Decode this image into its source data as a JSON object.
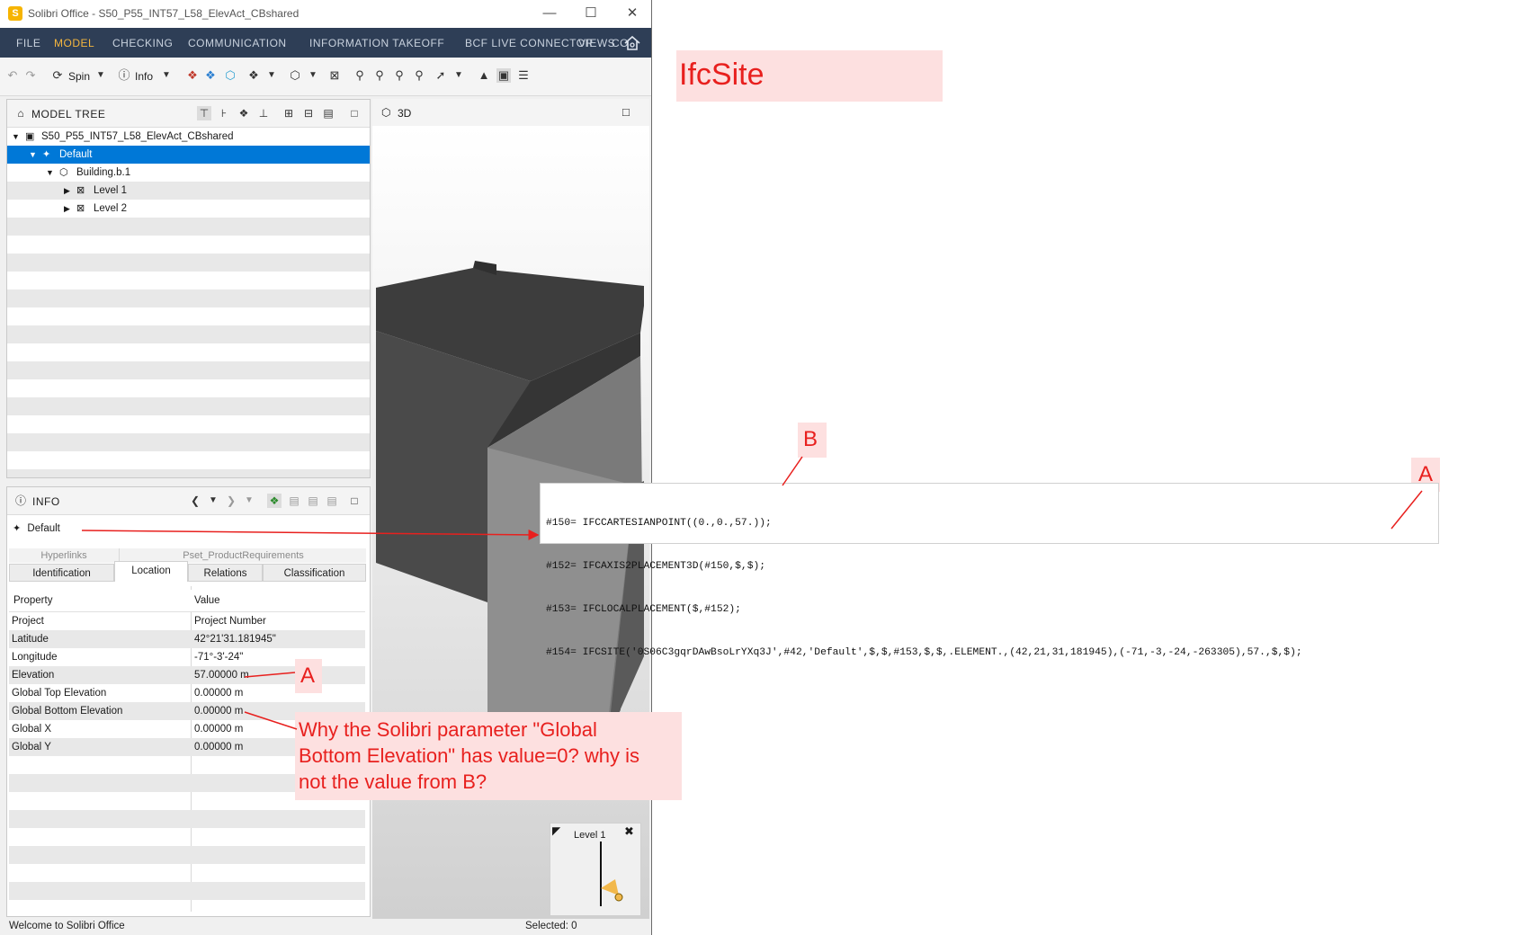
{
  "window": {
    "title": "Solibri Office - S50_P55_INT57_L58_ElevAct_CBshared",
    "logo_letter": "S",
    "controls": [
      "—",
      "☐",
      "✕"
    ]
  },
  "menu": [
    {
      "label": "FILE",
      "active": false
    },
    {
      "label": "MODEL",
      "active": true
    },
    {
      "label": "CHECKING",
      "active": false
    },
    {
      "label": "COMMUNICATION",
      "active": false
    },
    {
      "label": "INFORMATION TAKEOFF",
      "active": false
    },
    {
      "label": "BCF LIVE CONNECTOR",
      "active": false
    },
    {
      "label": "VIEWS",
      "active": false
    },
    {
      "label": "CO",
      "active": false
    }
  ],
  "toolbar": {
    "spin_label": "Spin",
    "info_label": "Info"
  },
  "model_tree": {
    "title": "MODEL TREE",
    "rows": [
      {
        "label": "S50_P55_INT57_L58_ElevAct_CBshared",
        "icon": "project-icon",
        "selected": false
      },
      {
        "label": "Default",
        "icon": "site-icon",
        "selected": true
      },
      {
        "label": "Building.b.1",
        "icon": "building-icon",
        "selected": false
      },
      {
        "label": "Level 1",
        "icon": "level-icon",
        "selected": false
      },
      {
        "label": "Level 2",
        "icon": "level-icon",
        "selected": false
      }
    ]
  },
  "view3d": {
    "title": "3D",
    "minimap_label": "Level 1"
  },
  "info": {
    "title": "INFO",
    "selected_item": "Default",
    "tabs_top": [
      "Hyperlinks",
      "Pset_ProductRequirements"
    ],
    "tabs": [
      "Identification",
      "Location",
      "Relations",
      "Classification"
    ],
    "active_tab": "Location",
    "columns": [
      "Property",
      "Value"
    ],
    "rows": [
      {
        "property": "Project",
        "value": "Project  Number"
      },
      {
        "property": "Latitude",
        "value": "42°21'31.181945\""
      },
      {
        "property": "Longitude",
        "value": "-71°-3'-24\""
      },
      {
        "property": "Elevation",
        "value": "57.00000 m"
      },
      {
        "property": "Global Top Elevation",
        "value": "0.00000 m"
      },
      {
        "property": "Global Bottom Elevation",
        "value": "0.00000 m"
      },
      {
        "property": "Global X",
        "value": "0.00000 m"
      },
      {
        "property": "Global Y",
        "value": "0.00000 m"
      }
    ]
  },
  "status": {
    "left": "Welcome to Solibri Office",
    "right": "Selected: 0"
  },
  "annotations": {
    "heading": "IfcSite",
    "label_a": "A",
    "label_b": "B",
    "ifc_code": [
      "#150= IFCCARTESIANPOINT((0.,0.,57.));",
      "#152= IFCAXIS2PLACEMENT3D(#150,$,$);",
      "#153= IFCLOCALPLACEMENT($,#152);",
      "#154= IFCSITE('0S06C3gqrDAwBsoLrYXq3J',#42,'Default',$,$,#153,$,$,.ELEMENT.,(42,21,31,181945),(-71,-3,-24,-263305),57.,$,$);"
    ],
    "question": "Why the Solibri parameter \"Global\nBottom Elevation\" has value=0? why is\nnot the value from B?",
    "accent_color": "#e8201e"
  }
}
